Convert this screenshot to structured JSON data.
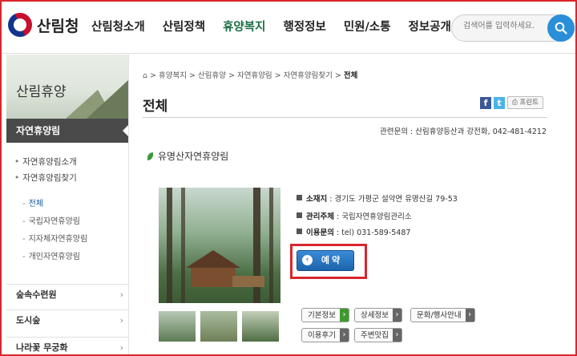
{
  "header": {
    "logo_text": "산림청",
    "nav": [
      "산림청소개",
      "산림정책",
      "휴양복지",
      "행정정보",
      "민원/소통",
      "정보공개"
    ],
    "active_nav": "휴양복지",
    "search_placeholder": "검색어를 입력하세요."
  },
  "sidebar": {
    "title": "산림휴양",
    "active": "자연휴양림",
    "sub_items": [
      "자연휴양림소개",
      "자연휴양림찾기"
    ],
    "sub_sub_items": [
      "전체",
      "국립자연휴양림",
      "지자체자연휴양림",
      "개인자연휴양림"
    ],
    "menus": [
      "숲속수련원",
      "도시숲",
      "나라꽃 무궁화"
    ]
  },
  "content": {
    "breadcrumb": [
      "휴양복지",
      "산림휴양",
      "자연휴양림",
      "자연휴양림찾기",
      "전체"
    ],
    "page_title": "전체",
    "share": {
      "facebook": "f",
      "twitter": "t",
      "print": "프린트"
    },
    "contact": "관련문의 : 산림휴양등산과 강전화, 042-481-4212",
    "place_name": "유명산자연휴양림",
    "info": [
      {
        "label": "소재지",
        "value": " : 경기도 가평군 설악면 유명산길 79-53"
      },
      {
        "label": "관리주체",
        "value": " : 국립자연휴양림관리소"
      },
      {
        "label": "이용문의",
        "value": " : tel) 031-589-5487"
      }
    ],
    "reserve_label": "예약",
    "tabs": [
      "기본정보",
      "상세정보",
      "문화/행사안내",
      "이용후기",
      "주변맛집"
    ]
  },
  "colors": {
    "accent_red": "#d9262c",
    "active_nav": "#1a6e44",
    "button_blue": "#1c63ad"
  }
}
